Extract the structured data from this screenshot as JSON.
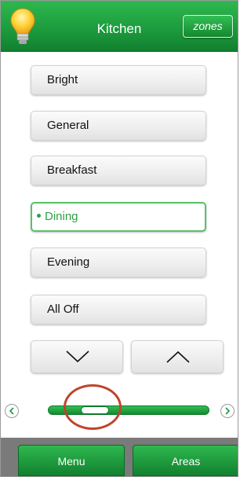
{
  "header": {
    "title": "Kitchen",
    "zones_label": "zones",
    "icon": "lightbulb-icon"
  },
  "scenes": [
    {
      "label": "Bright",
      "active": false
    },
    {
      "label": "General",
      "active": false
    },
    {
      "label": "Breakfast",
      "active": false
    },
    {
      "label": "Dining",
      "active": true
    },
    {
      "label": "Evening",
      "active": false
    },
    {
      "label": "All Off",
      "active": false
    }
  ],
  "scroll": {
    "down_icon": "chevron-down-icon",
    "up_icon": "chevron-up-icon"
  },
  "slider": {
    "level_fraction": 0.3
  },
  "footer": {
    "menu_label": "Menu",
    "areas_label": "Areas"
  },
  "colors": {
    "accent_green": "#1d9c3e",
    "highlight_ring": "#c0442b"
  }
}
